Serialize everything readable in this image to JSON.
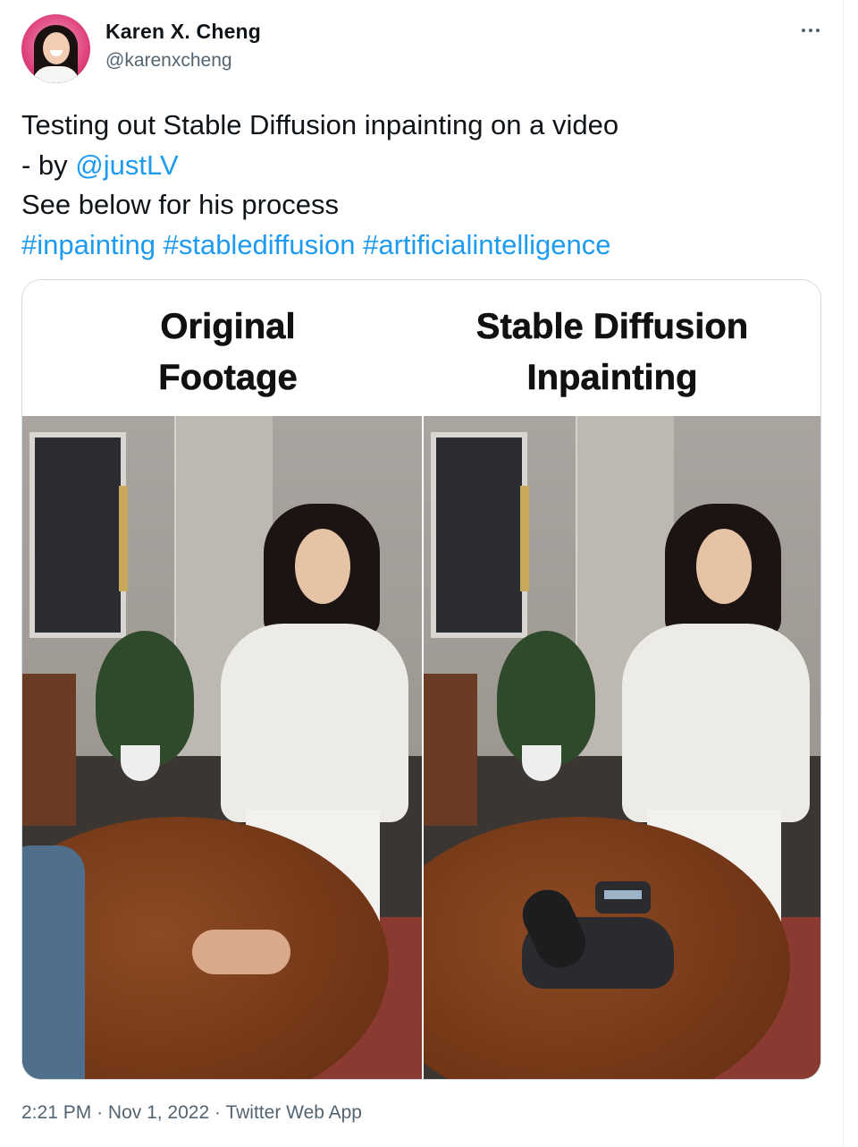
{
  "author": {
    "name": "Karen X. Cheng",
    "handle": "@karenxcheng"
  },
  "more_icon": "more-horizontal-icon",
  "tweet": {
    "line1": "Testing out Stable Diffusion inpainting on a video",
    "line2_prefix": "- by ",
    "mention": "@justLV",
    "line3": "See below for his process",
    "hashtags": [
      "#inpainting",
      "#stablediffusion",
      "#artificialintelligence"
    ]
  },
  "media": {
    "left_title_1": "Original",
    "left_title_2": "Footage",
    "right_title_1": "Stable Diffusion",
    "right_title_2": "Inpainting"
  },
  "meta": {
    "time": "2:21 PM",
    "date": "Nov 1, 2022",
    "source": "Twitter Web App",
    "separator": "·"
  },
  "colors": {
    "link": "#1d9bf0",
    "secondary_text": "#536471",
    "primary_text": "#0f1419"
  }
}
